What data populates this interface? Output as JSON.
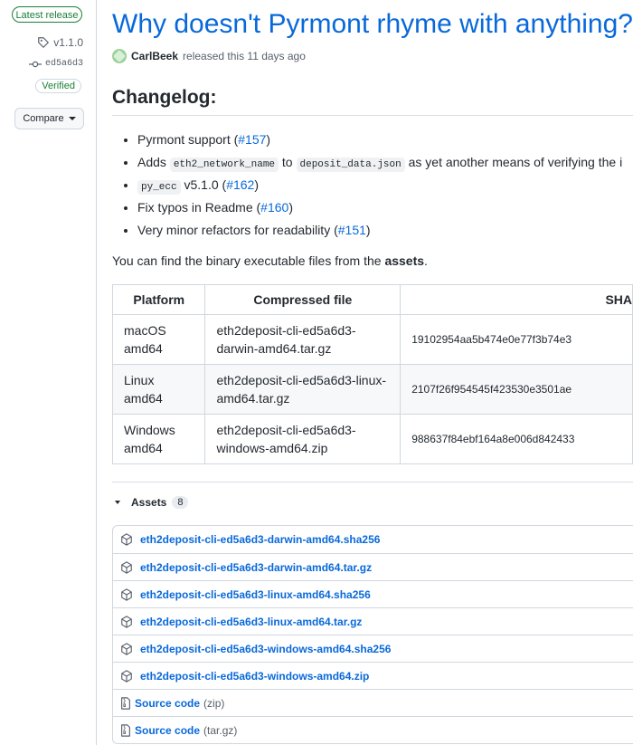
{
  "sidebar": {
    "latest_badge": "Latest release",
    "tag": "v1.1.0",
    "commit": "ed5a6d3",
    "verified": "Verified",
    "compare_label": "Compare"
  },
  "release": {
    "title": "Why doesn't Pyrmont rhyme with anything?",
    "author": "CarlBeek",
    "released_text": "released this 11 days ago",
    "changelog_heading": "Changelog:"
  },
  "changes": [
    {
      "text": "Pyrmont support (",
      "link": "#157",
      "suffix": ")"
    },
    {
      "pre": "Adds ",
      "code1": "eth2_network_name",
      "mid": " to ",
      "code2": "deposit_data.json",
      "post": " as yet another means of verifying the i"
    },
    {
      "code": "py_ecc",
      "text": " v5.1.0 (",
      "link": "#162",
      "suffix": ")"
    },
    {
      "text": "Fix typos in Readme (",
      "link": "#160",
      "suffix": ")"
    },
    {
      "text": "Very minor refactors for readability (",
      "link": "#151",
      "suffix": ")"
    }
  ],
  "binaries_paragraph": {
    "pre": "You can find the binary executable files from the ",
    "bold": "assets",
    "post": "."
  },
  "table": {
    "headers": [
      "Platform",
      "Compressed file",
      "SHA"
    ],
    "rows": [
      {
        "platform": "macOS amd64",
        "file": "eth2deposit-cli-ed5a6d3-darwin-amd64.tar.gz",
        "sha": "19102954aa5b474e0e77f3b74e3"
      },
      {
        "platform": "Linux amd64",
        "file": "eth2deposit-cli-ed5a6d3-linux-amd64.tar.gz",
        "sha": "2107f26f954545f423530e3501ae"
      },
      {
        "platform": "Windows amd64",
        "file": "eth2deposit-cli-ed5a6d3-windows-amd64.zip",
        "sha": "988637f84ebf164a8e006d842433"
      }
    ]
  },
  "assets": {
    "title": "Assets",
    "count": "8",
    "files": [
      "eth2deposit-cli-ed5a6d3-darwin-amd64.sha256",
      "eth2deposit-cli-ed5a6d3-darwin-amd64.tar.gz",
      "eth2deposit-cli-ed5a6d3-linux-amd64.sha256",
      "eth2deposit-cli-ed5a6d3-linux-amd64.tar.gz",
      "eth2deposit-cli-ed5a6d3-windows-amd64.sha256",
      "eth2deposit-cli-ed5a6d3-windows-amd64.zip"
    ],
    "source": [
      {
        "label": "Source code",
        "format": "(zip)"
      },
      {
        "label": "Source code",
        "format": "(tar.gz)"
      }
    ]
  },
  "colors": {
    "link": "#0969da",
    "verified": "#1a7f37",
    "border": "#d0d7de"
  }
}
